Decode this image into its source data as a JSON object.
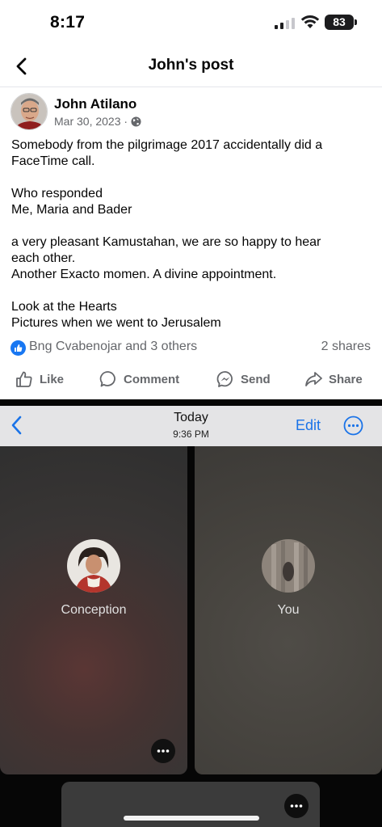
{
  "status_bar": {
    "time": "8:17",
    "battery": "83"
  },
  "nav": {
    "title": "John's post",
    "back_icon": "chevron-left-icon"
  },
  "post": {
    "author": "John Atilano",
    "date": "Mar 30, 2023 ·",
    "privacy_icon": "globe-icon",
    "lines": [
      "Somebody from the pilgrimage 2017 accidentally did a",
      "FaceTime call.",
      "",
      "Who responded",
      "Me, Maria and Bader",
      "",
      "a very pleasant Kamustahan, we are so happy to hear",
      "each other.",
      "Another Exacto momen. A divine appointment.",
      "",
      "Look at the Hearts",
      "Pictures when we went to Jerusalem"
    ],
    "reactions": "Bng Cvabenojar and 3 others",
    "shares": "2 shares"
  },
  "actions": {
    "like": "Like",
    "comment": "Comment",
    "send": "Send",
    "share": "Share"
  },
  "photo": {
    "header": {
      "day": "Today",
      "time": "9:36 PM",
      "edit": "Edit"
    },
    "participants": [
      {
        "name": "Conception"
      },
      {
        "name": "You"
      }
    ]
  },
  "colors": {
    "accent": "#1877f2",
    "ios_link": "#1a73e8",
    "secondary_text": "#65676b"
  }
}
